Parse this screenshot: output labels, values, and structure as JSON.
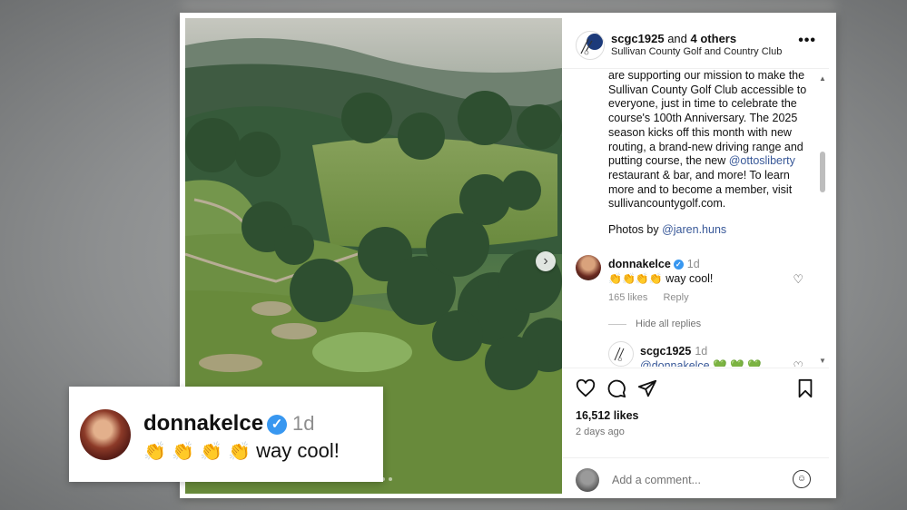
{
  "post": {
    "header": {
      "username": "scgc1925",
      "others_text": "and",
      "others_count": "4 others",
      "subtitle": "Sullivan County Golf and Country Club",
      "more_glyph": "•••"
    },
    "caption": {
      "text_before_link": "are supporting our mission to make the Sullivan County Golf Club accessible to everyone, just in time to celebrate the course's 100th Anniversary. The 2025 season kicks off this month with new routing, a brand-new driving range and putting course, the new ",
      "link": "@ottosliberty",
      "text_after_link": " restaurant & bar, and more! To learn more and to become a member, visit sullivancountygolf.com."
    },
    "credit": {
      "prefix": "Photos by ",
      "link": "@jaren.huns"
    },
    "comments": [
      {
        "username": "donnakelce",
        "verified": true,
        "time": "1d",
        "text": "way cool!",
        "emoji": "clapping-hands x4",
        "likes": "165 likes",
        "reply": "Reply",
        "hide_replies": "Hide all replies"
      },
      {
        "username": "scgc1925",
        "time": "1d",
        "mention": "@donnakelce",
        "hearts": "💚 💚 💚"
      }
    ],
    "likes": "16,512 likes",
    "time_ago": "2 days ago",
    "add_comment_placeholder": "Add a comment...",
    "next_glyph": "›"
  },
  "callout": {
    "username": "donnakelce",
    "time": "1d",
    "text": "way cool!",
    "verified_glyph": "✓"
  },
  "icons": [
    "heart-icon",
    "comment-icon",
    "share-icon",
    "bookmark-icon",
    "emoji-icon",
    "verified-icon",
    "clap-icon"
  ],
  "colors": {
    "link": "#385898",
    "verified": "#3897f0",
    "muted": "#8e8e8e"
  }
}
